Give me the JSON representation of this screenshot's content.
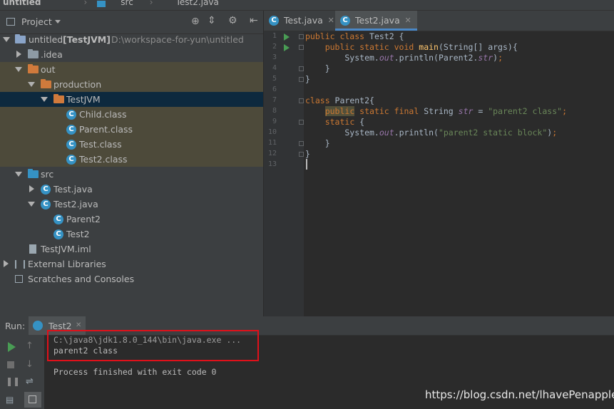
{
  "breadcrumb": {
    "project": "untitled",
    "folder": "src",
    "file": "Test2.java"
  },
  "project_panel": {
    "title": "Project",
    "tree": [
      {
        "label": "untitled",
        "module": "[TestJVM]",
        "path": "D:\\workspace-for-yun\\untitled"
      },
      {
        "label": ".idea"
      },
      {
        "label": "out"
      },
      {
        "label": "production"
      },
      {
        "label": "TestJVM"
      },
      {
        "label": "Child.class"
      },
      {
        "label": "Parent.class"
      },
      {
        "label": "Test.class"
      },
      {
        "label": "Test2.class"
      },
      {
        "label": "src"
      },
      {
        "label": "Test.java"
      },
      {
        "label": "Test2.java"
      },
      {
        "label": "Parent2"
      },
      {
        "label": "Test2"
      },
      {
        "label": "TestJVM.iml"
      },
      {
        "label": "External Libraries"
      },
      {
        "label": "Scratches and Consoles"
      }
    ]
  },
  "editor": {
    "tabs": [
      {
        "label": "Test.java"
      },
      {
        "label": "Test2.java"
      }
    ],
    "active_tab": "Test2.java",
    "line_numbers": [
      "1",
      "2",
      "3",
      "4",
      "5",
      "6",
      "7",
      "8",
      "9",
      "10",
      "11",
      "12",
      "13"
    ]
  },
  "run_panel": {
    "label": "Run:",
    "tab": "Test2",
    "console": [
      "C:\\java8\\jdk1.8.0_144\\bin\\java.exe ...",
      "parent2 class",
      "",
      "Process finished with exit code 0"
    ]
  },
  "watermark": "https://blog.csdn.net/lhavePenapple",
  "colors": {
    "selection": "#0d293e",
    "excluded": "#4d4a3a",
    "keyword": "#cc7832",
    "string": "#6a8759",
    "highlight_box": "#e0101a"
  }
}
